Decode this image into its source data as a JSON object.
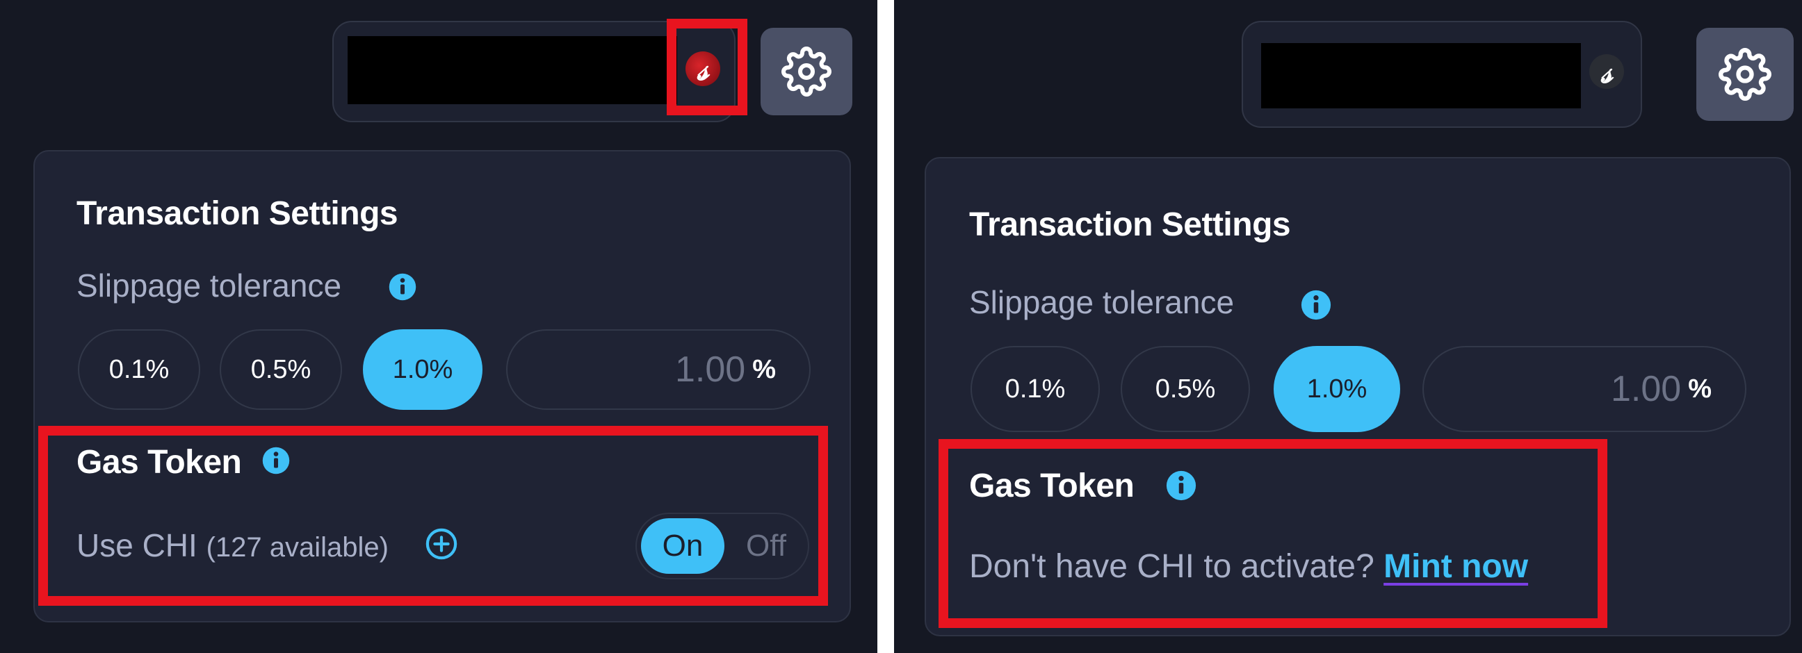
{
  "colors": {
    "background": "#151823",
    "card": "#1f2334",
    "accent": "#3fc0f7",
    "highlight": "#e8141f",
    "settings_button": "#4a5066",
    "link_underline": "#7b3fe4"
  },
  "icons": {
    "settings": "gear-icon",
    "info": "info-icon",
    "add": "plus-circle-icon",
    "avatar": "wallet-avatar"
  },
  "left": {
    "settings_card": {
      "title": "Transaction Settings",
      "slippage_label": "Slippage tolerance",
      "slippage_options": [
        "0.1%",
        "0.5%",
        "1.0%"
      ],
      "selected_option": "1.0%",
      "custom_value": "1.00",
      "custom_unit": "%"
    },
    "gas_token": {
      "title": "Gas Token",
      "use_label": "Use CHI",
      "available": "(127 available)",
      "toggle_on": "On",
      "toggle_off": "Off",
      "toggle_state": "On"
    }
  },
  "right": {
    "settings_card": {
      "title": "Transaction Settings",
      "slippage_label": "Slippage tolerance",
      "slippage_options": [
        "0.1%",
        "0.5%",
        "1.0%"
      ],
      "selected_option": "1.0%",
      "custom_value": "1.00",
      "custom_unit": "%"
    },
    "gas_token": {
      "title": "Gas Token",
      "prompt": "Don't have CHI to activate?",
      "mint_link": "Mint now"
    }
  }
}
